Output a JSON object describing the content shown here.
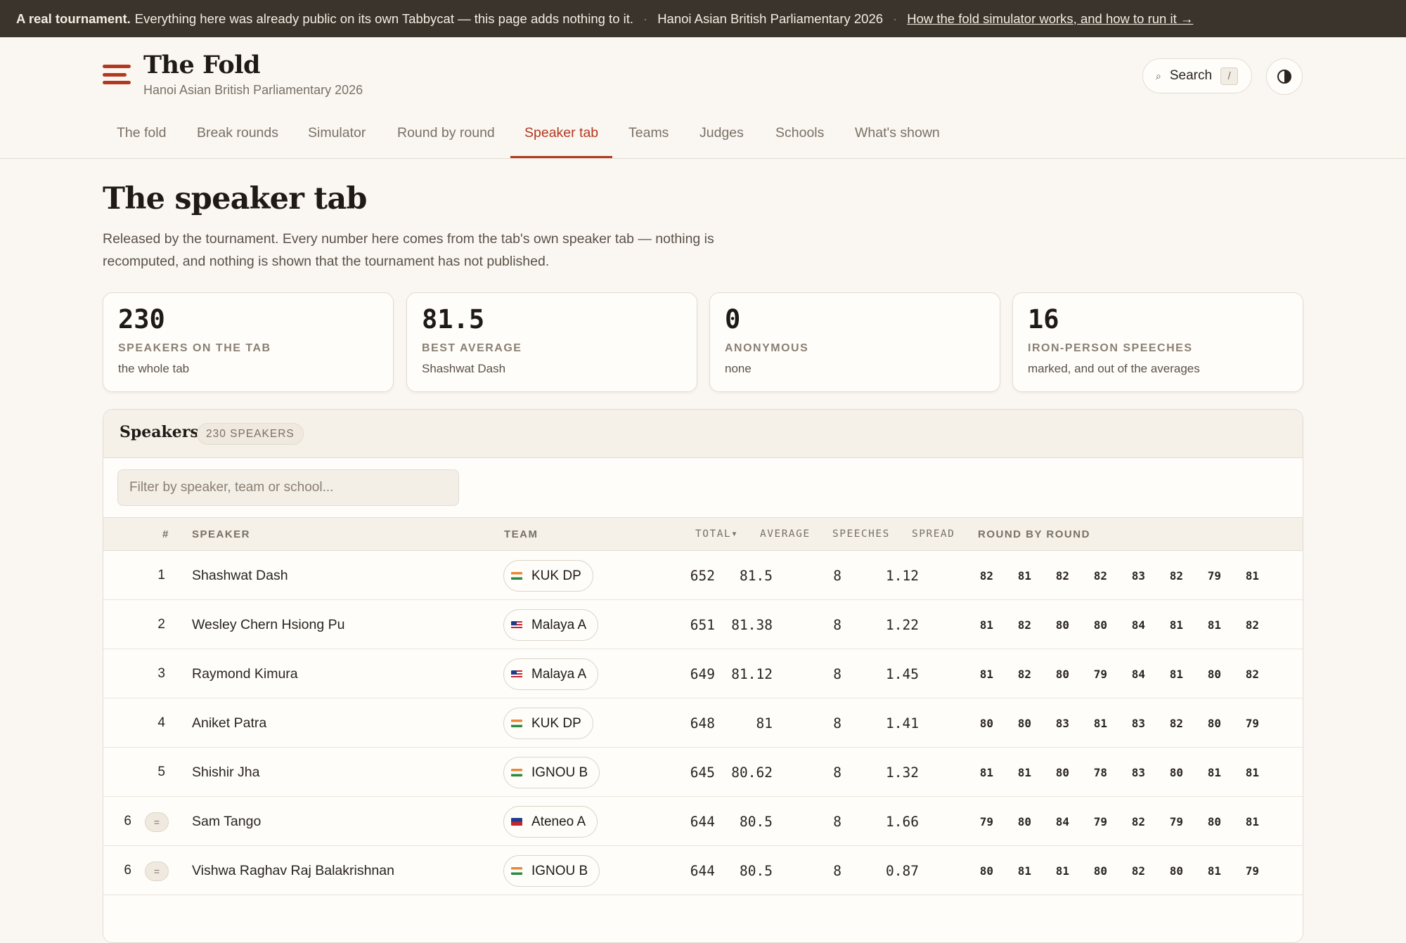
{
  "banner": {
    "strong": "A real tournament.",
    "text": "Everything here was already public on its own Tabbycat — this page adds nothing to it.",
    "tournament": "Hanoi Asian British Parliamentary 2026",
    "link": "How the fold simulator works, and how to run it →"
  },
  "header": {
    "title": "The Fold",
    "subtitle": "Hanoi Asian British Parliamentary 2026",
    "search_label": "Search",
    "search_key": "/"
  },
  "nav": [
    "The fold",
    "Break rounds",
    "Simulator",
    "Round by round",
    "Speaker tab",
    "Teams",
    "Judges",
    "Schools",
    "What's shown"
  ],
  "page": {
    "title": "The speaker tab",
    "intro": "Released by the tournament. Every number here comes from the tab's own speaker tab — nothing is recomputed, and nothing is shown that the tournament has not published."
  },
  "stats": [
    {
      "value": "230",
      "label": "SPEAKERS ON THE TAB",
      "note": "the whole tab"
    },
    {
      "value": "81.5",
      "label": "BEST AVERAGE",
      "note": "Shashwat Dash"
    },
    {
      "value": "0",
      "label": "ANONYMOUS",
      "note": "none"
    },
    {
      "value": "16",
      "label": "IRON-PERSON SPEECHES",
      "note": "marked, and out of the averages"
    }
  ],
  "panel": {
    "title": "Speakers",
    "count": "230 SPEAKERS",
    "filter_placeholder": "Filter by speaker, team or school..."
  },
  "columns": {
    "rank": "#",
    "speaker": "SPEAKER",
    "team": "TEAM",
    "total": "TOTAL▾",
    "average": "AVERAGE",
    "speeches": "SPEECHES",
    "spread": "SPREAD",
    "rounds": "ROUND BY ROUND"
  },
  "flags": {
    "india": "flag-india-icon",
    "malaysia": "flag-malaysia-icon",
    "philippines": "flag-philippines-icon"
  },
  "rows": [
    {
      "rank": "1",
      "tied": false,
      "speaker": "Shashwat Dash",
      "team": "KUK DP",
      "flag": "india",
      "total": "652",
      "average": "81.5",
      "speeches": "8",
      "spread": "1.12",
      "rounds": [
        "82",
        "81",
        "82",
        "82",
        "83",
        "82",
        "79",
        "81"
      ]
    },
    {
      "rank": "2",
      "tied": false,
      "speaker": "Wesley Chern Hsiong Pu",
      "team": "Malaya A",
      "flag": "malaysia",
      "total": "651",
      "average": "81.38",
      "speeches": "8",
      "spread": "1.22",
      "rounds": [
        "81",
        "82",
        "80",
        "80",
        "84",
        "81",
        "81",
        "82"
      ]
    },
    {
      "rank": "3",
      "tied": false,
      "speaker": "Raymond Kimura",
      "team": "Malaya A",
      "flag": "malaysia",
      "total": "649",
      "average": "81.12",
      "speeches": "8",
      "spread": "1.45",
      "rounds": [
        "81",
        "82",
        "80",
        "79",
        "84",
        "81",
        "80",
        "82"
      ]
    },
    {
      "rank": "4",
      "tied": false,
      "speaker": "Aniket Patra",
      "team": "KUK DP",
      "flag": "india",
      "total": "648",
      "average": "81",
      "speeches": "8",
      "spread": "1.41",
      "rounds": [
        "80",
        "80",
        "83",
        "81",
        "83",
        "82",
        "80",
        "79"
      ]
    },
    {
      "rank": "5",
      "tied": false,
      "speaker": "Shishir Jha",
      "team": "IGNOU B",
      "flag": "india",
      "total": "645",
      "average": "80.62",
      "speeches": "8",
      "spread": "1.32",
      "rounds": [
        "81",
        "81",
        "80",
        "78",
        "83",
        "80",
        "81",
        "81"
      ]
    },
    {
      "rank": "6",
      "tied": true,
      "tie_mark": "=",
      "speaker": "Sam Tango",
      "team": "Ateneo A",
      "flag": "philippines",
      "total": "644",
      "average": "80.5",
      "speeches": "8",
      "spread": "1.66",
      "rounds": [
        "79",
        "80",
        "84",
        "79",
        "82",
        "79",
        "80",
        "81"
      ]
    },
    {
      "rank": "6",
      "tied": true,
      "tie_mark": "=",
      "speaker": "Vishwa Raghav Raj Balakrishnan",
      "team": "IGNOU B",
      "flag": "india",
      "total": "644",
      "average": "80.5",
      "speeches": "8",
      "spread": "0.87",
      "rounds": [
        "80",
        "81",
        "81",
        "80",
        "82",
        "80",
        "81",
        "79"
      ]
    }
  ]
}
